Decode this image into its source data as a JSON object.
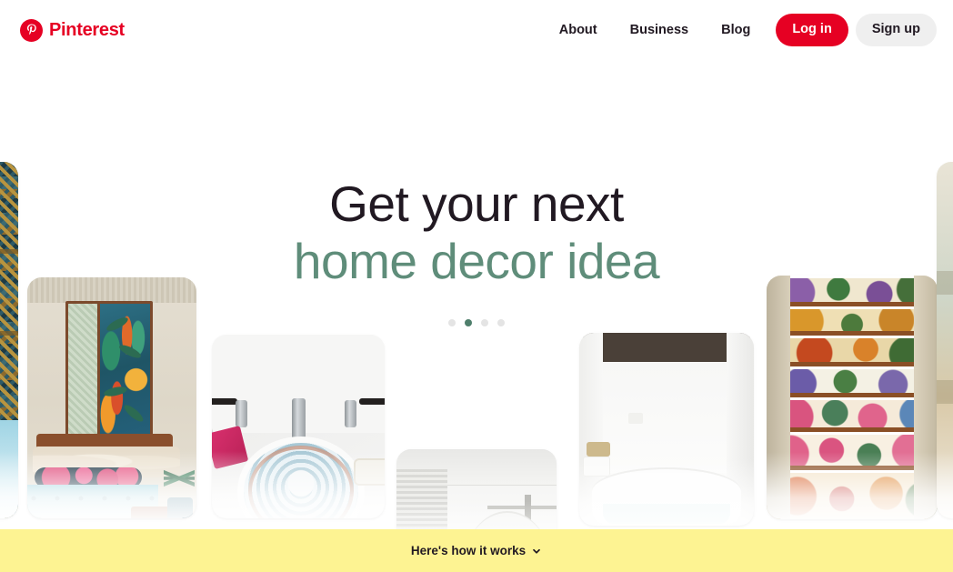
{
  "header": {
    "brand_name": "Pinterest",
    "brand_icon": "pinterest-p-logo-icon",
    "brand_color": "#e60023",
    "nav_links": [
      {
        "label": "About"
      },
      {
        "label": "Business"
      },
      {
        "label": "Blog"
      }
    ],
    "login_label": "Log in",
    "signup_label": "Sign up",
    "login_bg": "#e60023",
    "login_text_color": "#ffffff",
    "signup_bg": "#efefef",
    "signup_text_color": "#211922"
  },
  "hero": {
    "heading_line1": "Get your next",
    "heading_line2": "home decor idea",
    "line1_color": "#211922",
    "line2_color": "#5f8d7a",
    "carousel": {
      "dot_count": 4,
      "active_index": 1,
      "active_color": "#4f7f6c",
      "inactive_color": "#e4e4e4"
    },
    "scroll_button": {
      "icon": "chevron-down-icon",
      "bg": "#567f6f",
      "icon_color": "#ffffff"
    },
    "cards": [
      {
        "name": "moroccan-tile-wall",
        "alt": "Patterned tile wall with pool"
      },
      {
        "name": "bedroom-tropical-art",
        "alt": "Bedroom with tropical wall art and teal bedspread"
      },
      {
        "name": "decorative-sink",
        "alt": "Marble bathroom with blue patterned sink basin"
      },
      {
        "name": "light-interior",
        "alt": "Bright minimal interior detail"
      },
      {
        "name": "white-bathroom-tub",
        "alt": "White bathroom with freestanding tub and dark ceiling"
      },
      {
        "name": "floral-wallpaper-stairs",
        "alt": "Staircase with vintage floral wallpapered risers"
      },
      {
        "name": "edge-preview-right",
        "alt": "Partially visible next image"
      }
    ]
  },
  "footer": {
    "cta_label": "Here's how it works",
    "cta_icon": "chevron-down-icon",
    "bg": "#fdf392",
    "text_color": "#211922"
  }
}
